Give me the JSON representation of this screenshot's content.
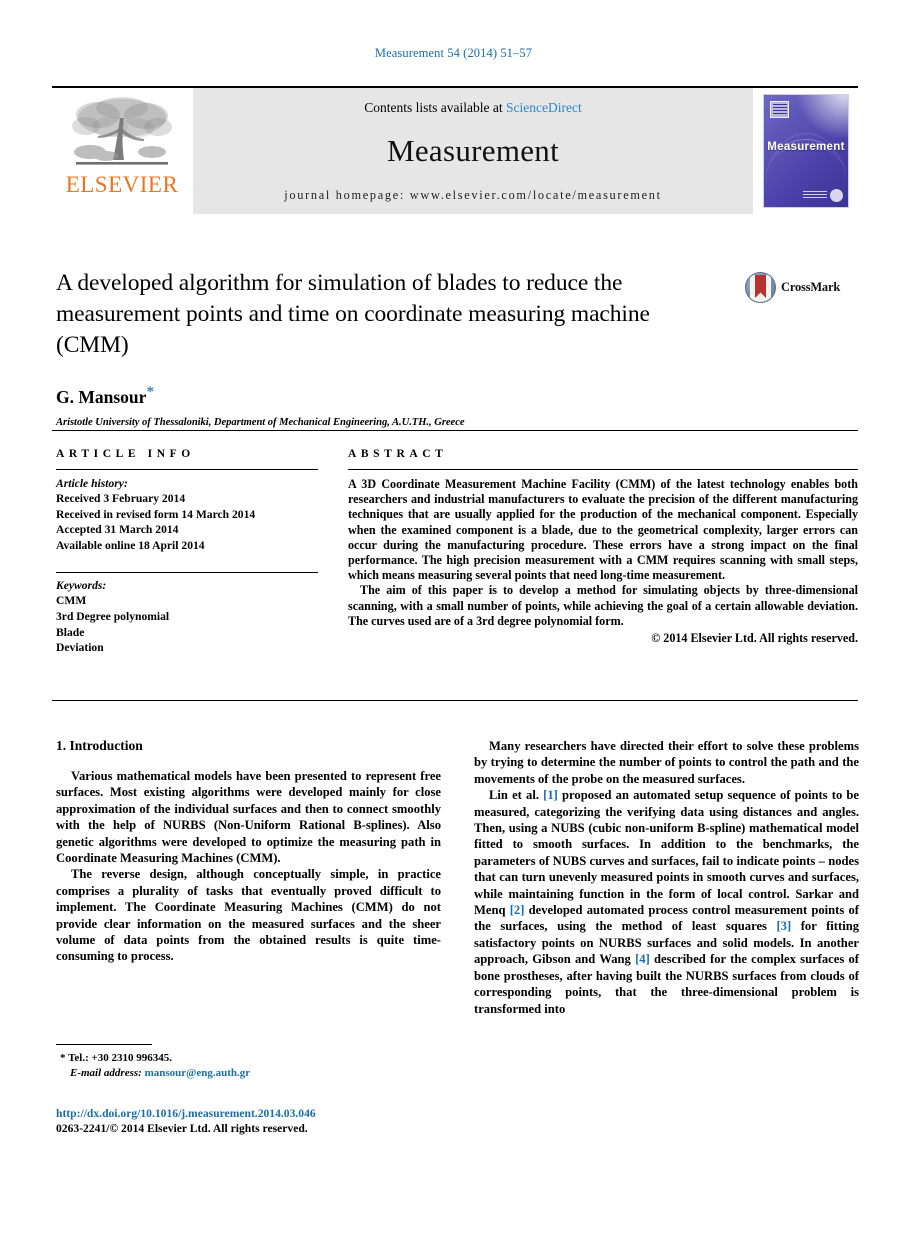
{
  "running_head": "Measurement 54 (2014) 51–57",
  "masthead": {
    "contents_prefix": "Contents lists available at ",
    "sciencedirect": "ScienceDirect",
    "journal_name": "Measurement",
    "homepage": "journal homepage: www.elsevier.com/locate/measurement",
    "publisher_logo_text": "ELSEVIER",
    "cover_title": "Measurement"
  },
  "article": {
    "title": "A developed algorithm for simulation of blades to reduce the measurement points and time on coordinate measuring machine (CMM)",
    "author": "G. Mansour",
    "author_marker": "*",
    "affiliation": "Aristotle University of Thessaloniki, Department of Mechanical Engineering, A.U.TH., Greece",
    "crossmark_label": "CrossMark"
  },
  "info": {
    "heading": "ARTICLE INFO",
    "history_label": "Article history:",
    "history": [
      "Received 3 February 2014",
      "Received in revised form 14 March 2014",
      "Accepted 31 March 2014",
      "Available online 18 April 2014"
    ],
    "keywords_label": "Keywords:",
    "keywords": [
      "CMM",
      "3rd Degree polynomial",
      "Blade",
      "Deviation"
    ]
  },
  "abstract": {
    "heading": "ABSTRACT",
    "paragraphs": [
      "A 3D Coordinate Measurement Machine Facility (CMM) of the latest technology enables both researchers and industrial manufacturers to evaluate the precision of the different manufacturing techniques that are usually applied for the production of the mechanical component. Especially when the examined component is a blade, due to the geometrical complexity, larger errors can occur during the manufacturing procedure. These errors have a strong impact on the final performance. The high precision measurement with a CMM requires scanning with small steps, which means measuring several points that need long-time measurement.",
      "The aim of this paper is to develop a method for simulating objects by three-dimensional scanning, with a small number of points, while achieving the goal of a certain allowable deviation. The curves used are of a 3rd degree polynomial form."
    ],
    "copyright": "© 2014 Elsevier Ltd. All rights reserved."
  },
  "body": {
    "section_title": "1. Introduction",
    "left_paragraphs": [
      "Various mathematical models have been presented to represent free surfaces. Most existing algorithms were developed mainly for close approximation of the individual surfaces and then to connect smoothly with the help of NURBS (Non-Uniform Rational B-splines). Also genetic algorithms were developed to optimize the measuring path in Coordinate Measuring Machines (CMM).",
      "The reverse design, although conceptually simple, in practice comprises a plurality of tasks that eventually proved difficult to implement. The Coordinate Measuring Machines (CMM) do not provide clear information on the measured surfaces and the sheer volume of data points from the obtained results is quite time-consuming to process."
    ],
    "right_paragraph_1": "Many researchers have directed their effort to solve these problems by trying to determine the number of points to control the path and the movements of the probe on the measured surfaces.",
    "right_paragraph_2": {
      "t1": "Lin et al. ",
      "c1": "[1]",
      "t2": " proposed an automated setup sequence of points to be measured, categorizing the verifying data using distances and angles. Then, using a NUBS (cubic non-uniform B-spline) mathematical model fitted to smooth surfaces. In addition to the benchmarks, the parameters of NUBS curves and surfaces, fail to indicate points – nodes that can turn unevenly measured points in smooth curves and surfaces, while maintaining function in the form of local control. Sarkar and Menq ",
      "c2": "[2]",
      "t3": " developed automated process control measurement points of the surfaces, using the method of least squares ",
      "c3": "[3]",
      "t4": " for fitting satisfactory points on NURBS surfaces and solid models. In another approach, Gibson and Wang ",
      "c4": "[4]",
      "t5": " described for the complex surfaces of bone prostheses, after having built the NURBS surfaces from clouds of corresponding points, that the three-dimensional problem is transformed into"
    }
  },
  "footnote": {
    "marker": "*",
    "tel": "Tel.: +30 2310 996345.",
    "email_label": "E-mail address:",
    "email": "mansour@eng.auth.gr"
  },
  "imprint": {
    "doi": "http://dx.doi.org/10.1016/j.measurement.2014.03.046",
    "issn": "0263-2241/© 2014 Elsevier Ltd. All rights reserved."
  },
  "colors": {
    "link": "#1a6ea8",
    "sciencedirect": "#2f86c6",
    "elsevier_orange": "#E87722",
    "crossmark_red": "#b7322c"
  }
}
